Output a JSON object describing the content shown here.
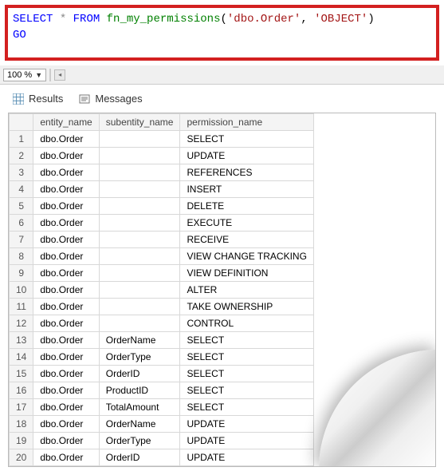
{
  "editor": {
    "line1_select": "SELECT",
    "line1_star": " * ",
    "line1_from": "FROM",
    "line1_fn": " fn_my_permissions",
    "line1_paren_open": "(",
    "line1_arg1": "'dbo.Order'",
    "line1_comma": ", ",
    "line1_arg2": "'OBJECT'",
    "line1_paren_close": ")",
    "line2": "GO"
  },
  "zoom": {
    "value": "100 %"
  },
  "tabs": {
    "results": "Results",
    "messages": "Messages"
  },
  "grid": {
    "headers": {
      "c0": "",
      "c1": "entity_name",
      "c2": "subentity_name",
      "c3": "permission_name"
    },
    "rows": [
      {
        "n": "1",
        "entity": "dbo.Order",
        "sub": "",
        "perm": "SELECT"
      },
      {
        "n": "2",
        "entity": "dbo.Order",
        "sub": "",
        "perm": "UPDATE"
      },
      {
        "n": "3",
        "entity": "dbo.Order",
        "sub": "",
        "perm": "REFERENCES"
      },
      {
        "n": "4",
        "entity": "dbo.Order",
        "sub": "",
        "perm": "INSERT"
      },
      {
        "n": "5",
        "entity": "dbo.Order",
        "sub": "",
        "perm": "DELETE"
      },
      {
        "n": "6",
        "entity": "dbo.Order",
        "sub": "",
        "perm": "EXECUTE"
      },
      {
        "n": "7",
        "entity": "dbo.Order",
        "sub": "",
        "perm": "RECEIVE"
      },
      {
        "n": "8",
        "entity": "dbo.Order",
        "sub": "",
        "perm": "VIEW CHANGE TRACKING"
      },
      {
        "n": "9",
        "entity": "dbo.Order",
        "sub": "",
        "perm": "VIEW DEFINITION"
      },
      {
        "n": "10",
        "entity": "dbo.Order",
        "sub": "",
        "perm": "ALTER"
      },
      {
        "n": "11",
        "entity": "dbo.Order",
        "sub": "",
        "perm": "TAKE OWNERSHIP"
      },
      {
        "n": "12",
        "entity": "dbo.Order",
        "sub": "",
        "perm": "CONTROL"
      },
      {
        "n": "13",
        "entity": "dbo.Order",
        "sub": "OrderName",
        "perm": "SELECT"
      },
      {
        "n": "14",
        "entity": "dbo.Order",
        "sub": "OrderType",
        "perm": "SELECT"
      },
      {
        "n": "15",
        "entity": "dbo.Order",
        "sub": "OrderID",
        "perm": "SELECT"
      },
      {
        "n": "16",
        "entity": "dbo.Order",
        "sub": "ProductID",
        "perm": "SELECT"
      },
      {
        "n": "17",
        "entity": "dbo.Order",
        "sub": "TotalAmount",
        "perm": "SELECT"
      },
      {
        "n": "18",
        "entity": "dbo.Order",
        "sub": "OrderName",
        "perm": "UPDATE"
      },
      {
        "n": "19",
        "entity": "dbo.Order",
        "sub": "OrderType",
        "perm": "UPDATE"
      },
      {
        "n": "20",
        "entity": "dbo.Order",
        "sub": "OrderID",
        "perm": "UPDATE"
      }
    ]
  }
}
